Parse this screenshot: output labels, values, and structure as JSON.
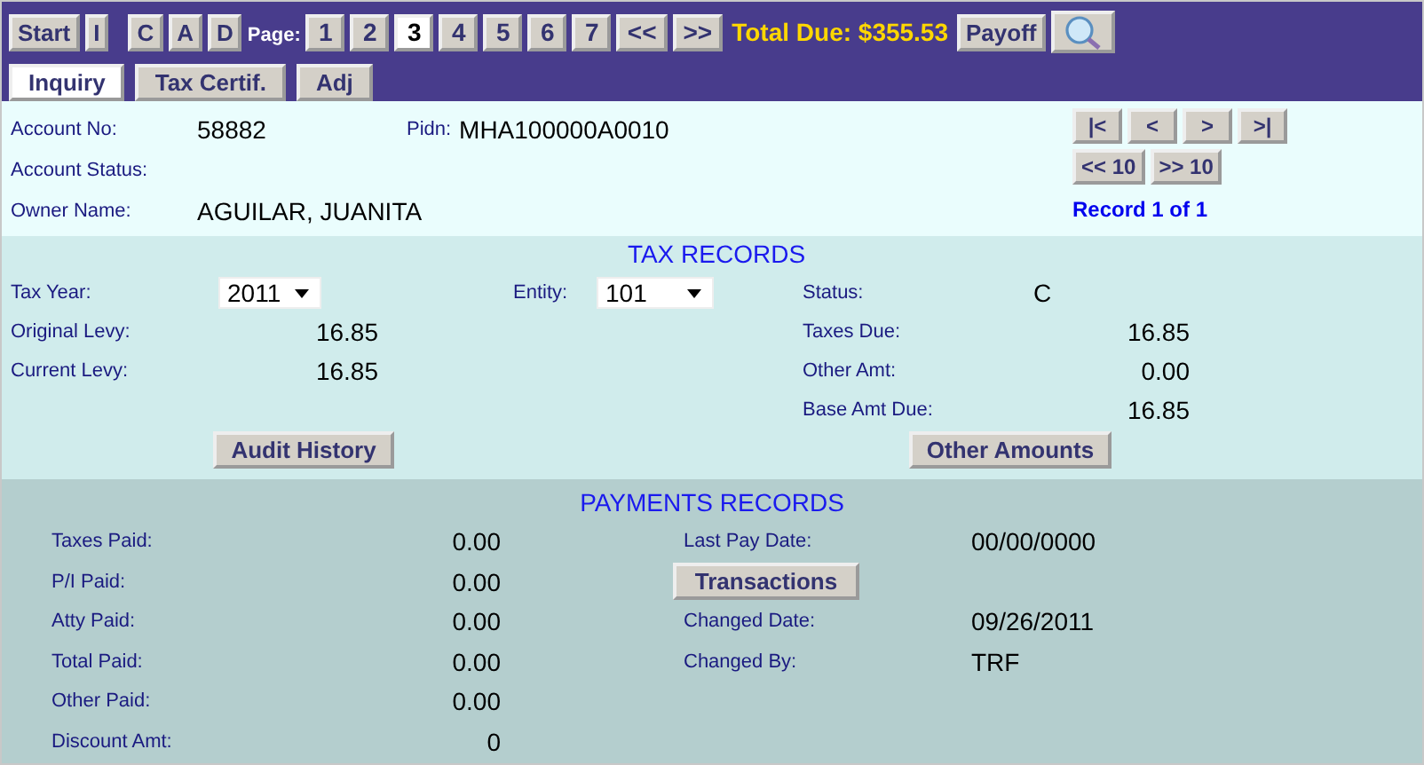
{
  "toolbar": {
    "start_buttons": [
      "Start",
      "I"
    ],
    "record_buttons": [
      "C",
      "A",
      "D"
    ],
    "page_label": "Page:",
    "pages": [
      {
        "label": "1",
        "selected": false
      },
      {
        "label": "2",
        "selected": false
      },
      {
        "label": "3",
        "selected": true
      },
      {
        "label": "4",
        "selected": false
      },
      {
        "label": "5",
        "selected": false
      },
      {
        "label": "6",
        "selected": false
      },
      {
        "label": "7",
        "selected": false
      }
    ],
    "page_nav": [
      "<<",
      ">>"
    ],
    "total_due": "Total Due: $355.53",
    "payoff": "Payoff"
  },
  "tabs": [
    {
      "label": "Inquiry",
      "selected": true
    },
    {
      "label": "Tax Certif.",
      "selected": false
    },
    {
      "label": "Adj",
      "selected": false
    }
  ],
  "account": {
    "account_no_label": "Account No:",
    "account_no": "58882",
    "pidn_label": "Pidn:",
    "pidn": "MHA100000A0010",
    "status_label": "Account Status:",
    "owner_label": "Owner Name:",
    "owner": "AGUILAR, JUANITA",
    "nav_buttons": [
      "|<",
      "<",
      ">",
      ">|"
    ],
    "jump_buttons": [
      "<< 10",
      ">> 10"
    ],
    "record_count": "Record 1 of 1"
  },
  "tax_records": {
    "title": "TAX RECORDS",
    "tax_year_label": "Tax Year:",
    "tax_year": "2011",
    "entity_label": "Entity:",
    "entity": "101",
    "status_label": "Status:",
    "status": "C",
    "left_rows": [
      {
        "label": "Original Levy:",
        "value": "16.85"
      },
      {
        "label": "Current Levy:",
        "value": "16.85"
      }
    ],
    "right_rows": [
      {
        "label": "Taxes Due:",
        "value": "16.85"
      },
      {
        "label": "Other Amt:",
        "value": "0.00"
      },
      {
        "label": "Base Amt Due:",
        "value": "16.85"
      }
    ],
    "buttons": [
      "Audit History",
      "Other Amounts"
    ]
  },
  "payments": {
    "title": "PAYMENTS RECORDS",
    "left_rows": [
      {
        "label": "Taxes Paid:",
        "value": "0.00"
      },
      {
        "label": "P/I Paid:",
        "value": "0.00"
      },
      {
        "label": "Atty Paid:",
        "value": "0.00"
      },
      {
        "label": "Total Paid:",
        "value": "0.00"
      },
      {
        "label": "Other Paid:",
        "value": "0.00"
      },
      {
        "label": "Discount Amt:",
        "value": "0"
      }
    ],
    "right_rows": [
      {
        "kind": "field",
        "label": "Last Pay Date:",
        "value": "00/00/0000"
      },
      {
        "kind": "button",
        "label": "Transactions"
      },
      {
        "kind": "field",
        "label": "Changed Date:",
        "value": "09/26/2011"
      },
      {
        "kind": "field",
        "label": "Changed By:",
        "value": "TRF"
      }
    ]
  }
}
